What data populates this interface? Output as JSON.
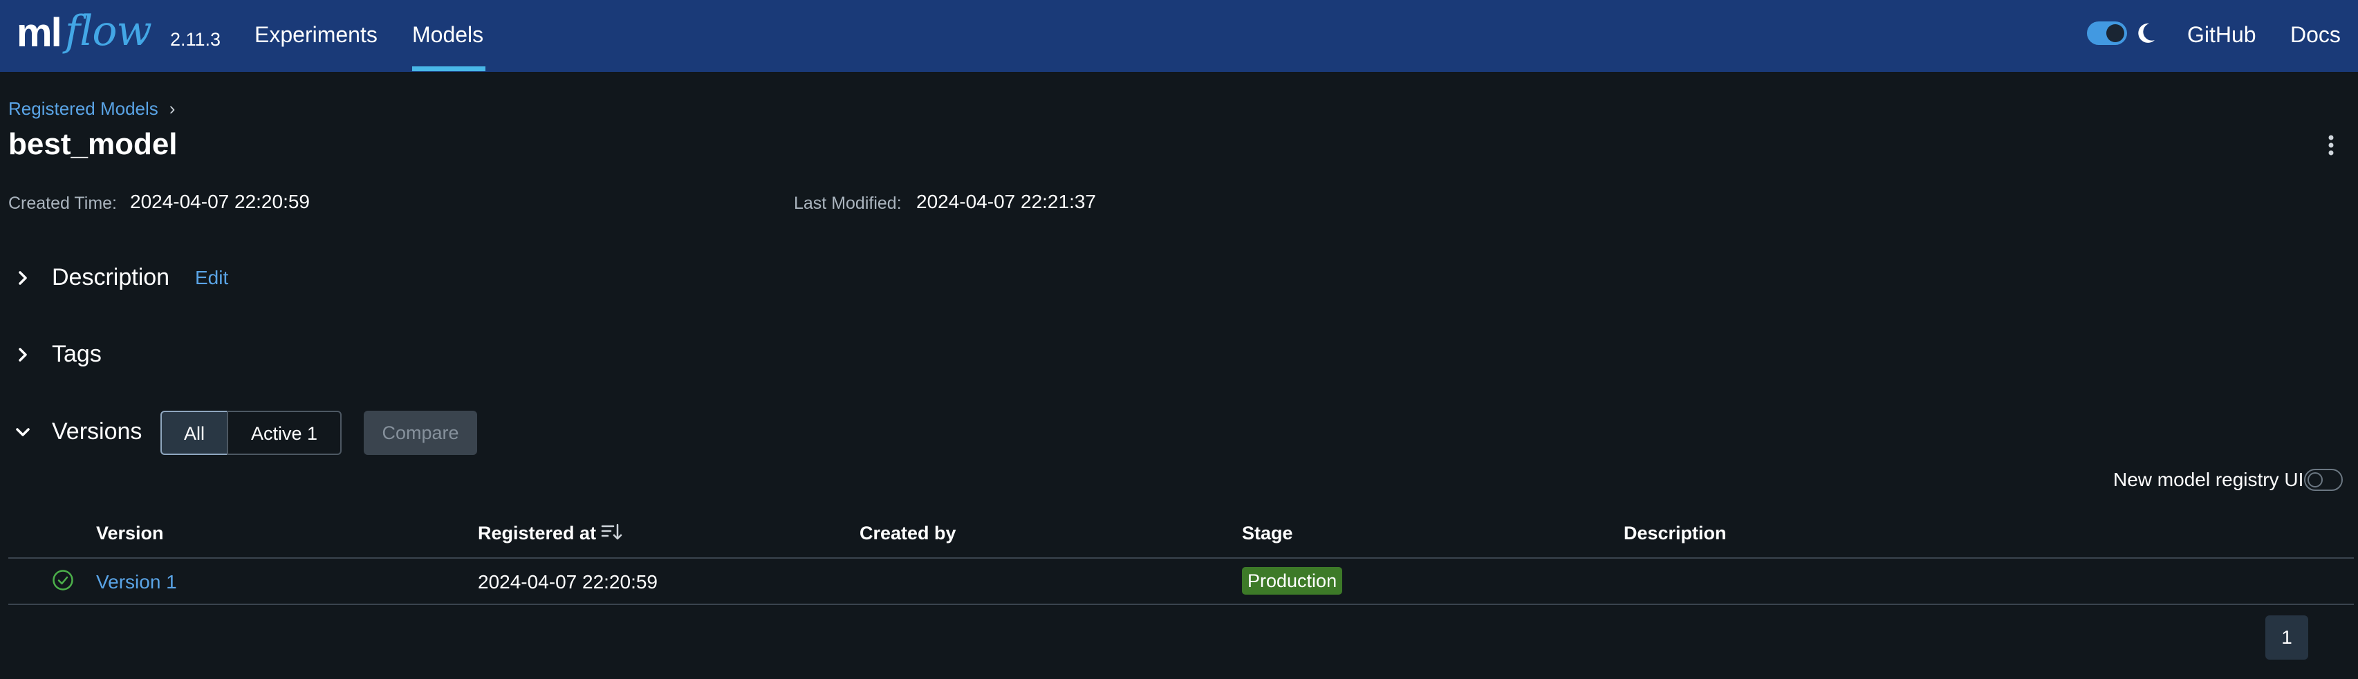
{
  "header": {
    "logo_ml": "ml",
    "logo_flow": "flow",
    "version": "2.11.3",
    "nav": [
      {
        "label": "Experiments",
        "active": false
      },
      {
        "label": "Models",
        "active": true
      }
    ],
    "github_label": "GitHub",
    "docs_label": "Docs",
    "theme_toggle_on": true,
    "icons": {
      "theme": "moon-icon"
    }
  },
  "breadcrumb": {
    "link": "Registered Models",
    "separator": "›"
  },
  "model": {
    "name": "best_model",
    "created_label": "Created Time:",
    "created_value": "2024-04-07 22:20:59",
    "modified_label": "Last Modified:",
    "modified_value": "2024-04-07 22:21:37"
  },
  "sections": {
    "description": {
      "title": "Description",
      "edit_label": "Edit",
      "expanded": false
    },
    "tags": {
      "title": "Tags",
      "expanded": false
    },
    "versions": {
      "title": "Versions",
      "expanded": true
    }
  },
  "filters": {
    "all_label": "All",
    "active_label": "Active 1",
    "selected": "All",
    "compare_label": "Compare"
  },
  "registry_toggle": {
    "label": "New model registry UI",
    "on": false
  },
  "table": {
    "columns": [
      "Version",
      "Registered at",
      "Created by",
      "Stage",
      "Description"
    ],
    "sort_column": "Registered at",
    "rows": [
      {
        "status": "ready",
        "version": "Version 1",
        "registered_at": "2024-04-07 22:20:59",
        "created_by": "",
        "stage": "Production",
        "description": ""
      }
    ]
  },
  "pagination": {
    "current_page": "1"
  },
  "colors": {
    "header_bg": "#1a3a78",
    "page_bg": "#11171c",
    "link": "#5aa4e6",
    "production_badge": "#3d7a28",
    "active_tab_indicator": "#49b8e8"
  }
}
